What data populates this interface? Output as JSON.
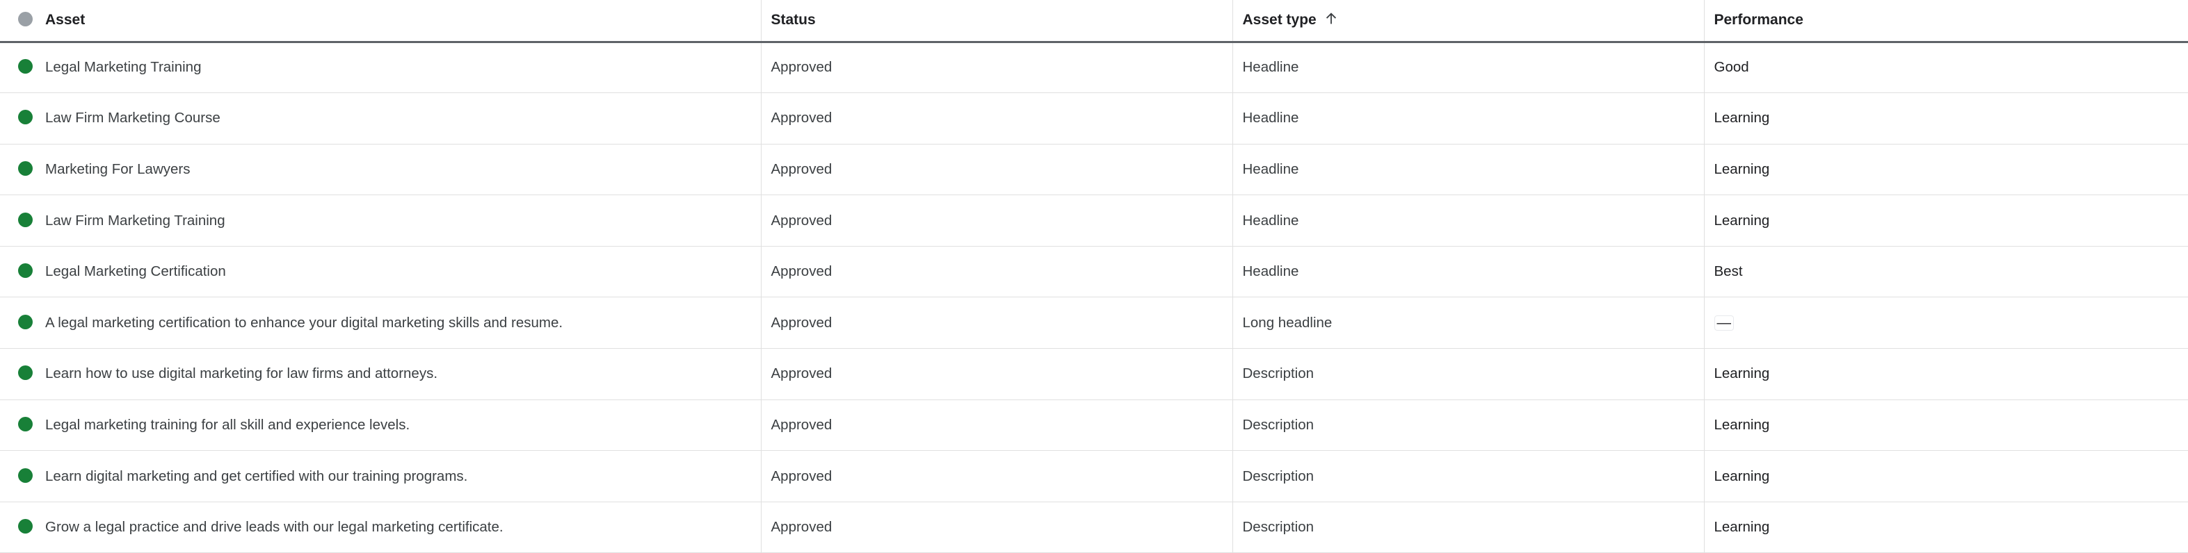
{
  "colors": {
    "approved_dot": "#188038",
    "header_dot": "#9aa0a6"
  },
  "header": {
    "asset": "Asset",
    "status": "Status",
    "asset_type": "Asset type",
    "asset_type_sort_icon": "arrow-up-icon",
    "performance": "Performance"
  },
  "rows": [
    {
      "asset": "Legal Marketing Training",
      "status": "Approved",
      "asset_type": "Headline",
      "performance": "Good"
    },
    {
      "asset": "Law Firm Marketing Course",
      "status": "Approved",
      "asset_type": "Headline",
      "performance": "Learning"
    },
    {
      "asset": "Marketing For Lawyers",
      "status": "Approved",
      "asset_type": "Headline",
      "performance": "Learning"
    },
    {
      "asset": "Law Firm Marketing Training",
      "status": "Approved",
      "asset_type": "Headline",
      "performance": "Learning"
    },
    {
      "asset": "Legal Marketing Certification",
      "status": "Approved",
      "asset_type": "Headline",
      "performance": "Best"
    },
    {
      "asset": "A legal marketing certification to enhance your digital marketing skills and resume.",
      "status": "Approved",
      "asset_type": "Long headline",
      "performance": "—"
    },
    {
      "asset": "Learn how to use digital marketing for law firms and attorneys.",
      "status": "Approved",
      "asset_type": "Description",
      "performance": "Learning"
    },
    {
      "asset": "Legal marketing training for all skill and experience levels.",
      "status": "Approved",
      "asset_type": "Description",
      "performance": "Learning"
    },
    {
      "asset": "Learn digital marketing and get certified with our training programs.",
      "status": "Approved",
      "asset_type": "Description",
      "performance": "Learning"
    },
    {
      "asset": "Grow a legal practice and drive leads with our legal marketing certificate.",
      "status": "Approved",
      "asset_type": "Description",
      "performance": "Learning"
    }
  ]
}
